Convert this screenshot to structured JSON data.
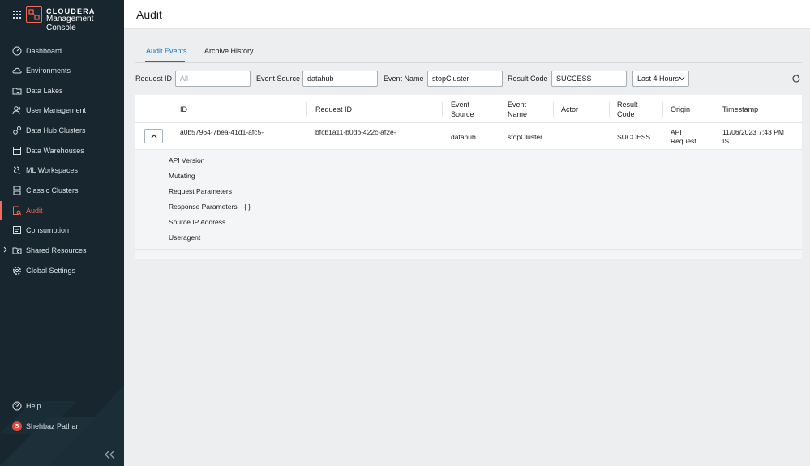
{
  "brand": {
    "line1": "CLOUDERA",
    "line2": "Management Console"
  },
  "nav": {
    "items": [
      {
        "label": "Dashboard",
        "icon": "dashboard-icon"
      },
      {
        "label": "Environments",
        "icon": "cloud-icon"
      },
      {
        "label": "Data Lakes",
        "icon": "data-lake-icon"
      },
      {
        "label": "User Management",
        "icon": "users-icon"
      },
      {
        "label": "Data Hub Clusters",
        "icon": "data-hub-icon"
      },
      {
        "label": "Data Warehouses",
        "icon": "warehouse-icon"
      },
      {
        "label": "ML Workspaces",
        "icon": "ml-icon"
      },
      {
        "label": "Classic Clusters",
        "icon": "server-icon"
      },
      {
        "label": "Audit",
        "icon": "audit-icon",
        "active": true
      },
      {
        "label": "Consumption",
        "icon": "consumption-icon"
      },
      {
        "label": "Shared Resources",
        "icon": "folder-icon"
      },
      {
        "label": "Global Settings",
        "icon": "gear-icon"
      }
    ],
    "help": "Help",
    "user": {
      "name": "Shehbaz Pathan",
      "initial": "S"
    }
  },
  "page": {
    "title": "Audit"
  },
  "tabs": [
    {
      "label": "Audit Events",
      "active": true
    },
    {
      "label": "Archive History",
      "active": false
    }
  ],
  "filters": {
    "request_id": {
      "label": "Request ID",
      "placeholder": "All",
      "value": ""
    },
    "event_source": {
      "label": "Event Source",
      "value": "datahub"
    },
    "event_name": {
      "label": "Event Name",
      "value": "stopCluster"
    },
    "result_code": {
      "label": "Result Code",
      "value": "SUCCESS"
    },
    "time_range": "Last 4 Hours"
  },
  "table": {
    "headers": {
      "id": "ID",
      "request_id": "Request ID",
      "event_source_1": "Event",
      "event_source_2": "Source",
      "event_name_1": "Event",
      "event_name_2": "Name",
      "actor": "Actor",
      "result_code_1": "Result",
      "result_code_2": "Code",
      "origin": "Origin",
      "timestamp": "Timestamp"
    },
    "row": {
      "id": "a0b57964-7bea-41d1-afc5-",
      "request_id": "bfcb1a11-b0db-422c-af2e-",
      "event_source": "datahub",
      "event_name": "stopCluster",
      "result_code": "SUCCESS",
      "origin_1": "API",
      "origin_2": "Request",
      "timestamp_1": "11/06/2023 7:43 PM",
      "timestamp_2": "IST"
    },
    "details": [
      {
        "label": "API Version",
        "value": ""
      },
      {
        "label": "Mutating",
        "value": ""
      },
      {
        "label": "Request Parameters",
        "value": ""
      },
      {
        "label": "Response Parameters",
        "value": "{ }"
      },
      {
        "label": "Source IP Address",
        "value": ""
      },
      {
        "label": "Useragent",
        "value": ""
      }
    ]
  },
  "colors": {
    "sidebar": "#17262f",
    "accent": "#f26b5b",
    "link": "#0a72c9"
  }
}
